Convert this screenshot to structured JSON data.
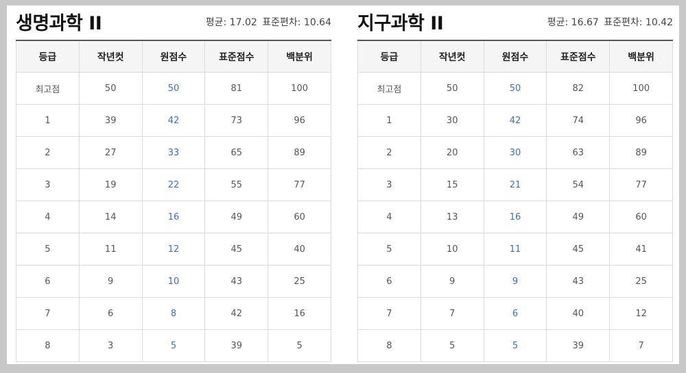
{
  "panels": [
    {
      "title": "생명과학 II",
      "stats": {
        "mean": "평균: 17.02",
        "std": "표준편차: 10.64"
      },
      "columns": [
        "등급",
        "작년컷",
        "원점수",
        "표준점수",
        "백분위"
      ],
      "rows": [
        [
          "최고점",
          "50",
          "50",
          "81",
          "100"
        ],
        [
          "1",
          "39",
          "42",
          "73",
          "96"
        ],
        [
          "2",
          "27",
          "33",
          "65",
          "89"
        ],
        [
          "3",
          "19",
          "22",
          "55",
          "77"
        ],
        [
          "4",
          "14",
          "16",
          "49",
          "60"
        ],
        [
          "5",
          "11",
          "12",
          "45",
          "40"
        ],
        [
          "6",
          "9",
          "10",
          "43",
          "25"
        ],
        [
          "7",
          "6",
          "8",
          "42",
          "16"
        ],
        [
          "8",
          "3",
          "5",
          "39",
          "5"
        ]
      ]
    },
    {
      "title": "지구과학 II",
      "stats": {
        "mean": "평균: 16.67",
        "std": "표준편차: 10.42"
      },
      "columns": [
        "등급",
        "작년컷",
        "원점수",
        "표준점수",
        "백분위"
      ],
      "rows": [
        [
          "최고점",
          "50",
          "50",
          "82",
          "100"
        ],
        [
          "1",
          "30",
          "42",
          "74",
          "96"
        ],
        [
          "2",
          "20",
          "30",
          "63",
          "89"
        ],
        [
          "3",
          "15",
          "21",
          "54",
          "77"
        ],
        [
          "4",
          "13",
          "16",
          "49",
          "60"
        ],
        [
          "5",
          "10",
          "11",
          "45",
          "41"
        ],
        [
          "6",
          "9",
          "9",
          "43",
          "25"
        ],
        [
          "7",
          "7",
          "6",
          "40",
          "12"
        ],
        [
          "8",
          "5",
          "5",
          "39",
          "7"
        ]
      ]
    }
  ],
  "colors": {
    "raw_score_text": "#3a6fc4",
    "header_background": "#f5f5f5",
    "page_background": "#c8c8c8"
  }
}
